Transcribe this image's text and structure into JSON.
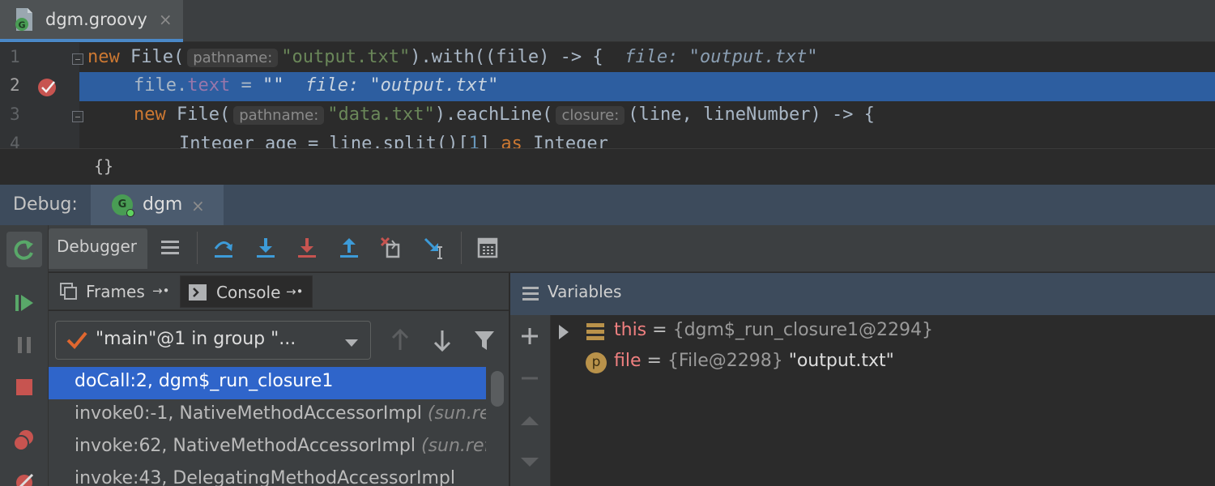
{
  "editor_tab": {
    "file_name": "dgm.groovy",
    "close_glyph": "×",
    "icon": "groovy-file-icon"
  },
  "code_lines": [
    {
      "number": "1"
    },
    {
      "number": "2"
    },
    {
      "number": "3"
    },
    {
      "number": "4"
    }
  ],
  "code": {
    "l1_new": "new",
    "l1_file": " File(",
    "l1_hint": "pathname:",
    "l1_str": "\"output.txt\"",
    "l1_rest": ").with((file) -> {  ",
    "l1_inline": "file: \"output.txt\"",
    "l2_file": "file.",
    "l2_text": "text",
    "l2_assign": " = ",
    "l2_str": "\"\"",
    "l2_inline": "file: \"output.txt\"",
    "l3_new": "new",
    "l3_file": " File(",
    "l3_hint": "pathname:",
    "l3_str": "\"data.txt\"",
    "l3_mid": ").eachLine(",
    "l3_hint2": "closure:",
    "l3_rest": "(line, lineNumber) -> {",
    "l4_a": "Integer age = line.split()[",
    "l4_num": "1",
    "l4_b": "] ",
    "l4_as": "as",
    "l4_c": " Integer"
  },
  "breadcrumb": "{}",
  "debug": {
    "label": "Debug:",
    "run_tab": {
      "name": "dgm",
      "close_glyph": "×",
      "icon_letter": "G"
    }
  },
  "left_toolbar": [
    "rerun-icon",
    "resume-icon",
    "pause-icon",
    "stop-icon",
    "view-breakpoints-icon",
    "mute-breakpoints-icon"
  ],
  "debugger_toolbar": {
    "tab_label": "Debugger",
    "buttons": [
      "layout-icon",
      "step-over-icon",
      "step-into-icon",
      "force-step-into-icon",
      "step-out-icon",
      "drop-frame-icon",
      "run-to-cursor-icon",
      "evaluate-expression-icon"
    ]
  },
  "frames_pane": {
    "tabs": [
      {
        "label": "Frames",
        "pin": "→•"
      },
      {
        "label": "Console",
        "pin": "→•"
      }
    ],
    "thread": "\"main\"@1 in group \"...",
    "frames": [
      {
        "method": "doCall:2, dgm$_run_closure1",
        "note": ""
      },
      {
        "method": "invoke0:-1, NativeMethodAccessorImpl",
        "note": "(sun.reflect)"
      },
      {
        "method": "invoke:62, NativeMethodAccessorImpl",
        "note": "(sun.reflect)"
      },
      {
        "method": "invoke:43, DelegatingMethodAccessorImpl",
        "note": ""
      }
    ]
  },
  "variables_pane": {
    "title": "Variables",
    "items": [
      {
        "name": "this",
        "eq": " = ",
        "type": "{dgm$_run_closure1@2294}",
        "value": "",
        "icon": "field-icon"
      },
      {
        "name": "file",
        "eq": " = ",
        "type": "{File@2298}",
        "value": " \"output.txt\"",
        "icon": "parameter-icon",
        "icon_letter": "p"
      }
    ]
  },
  "colors": {
    "accent_blue": "#2f65ca",
    "selection_line": "#2d5ea0",
    "breakpoint_red": "#c75450",
    "groovy_green": "#499c54"
  }
}
